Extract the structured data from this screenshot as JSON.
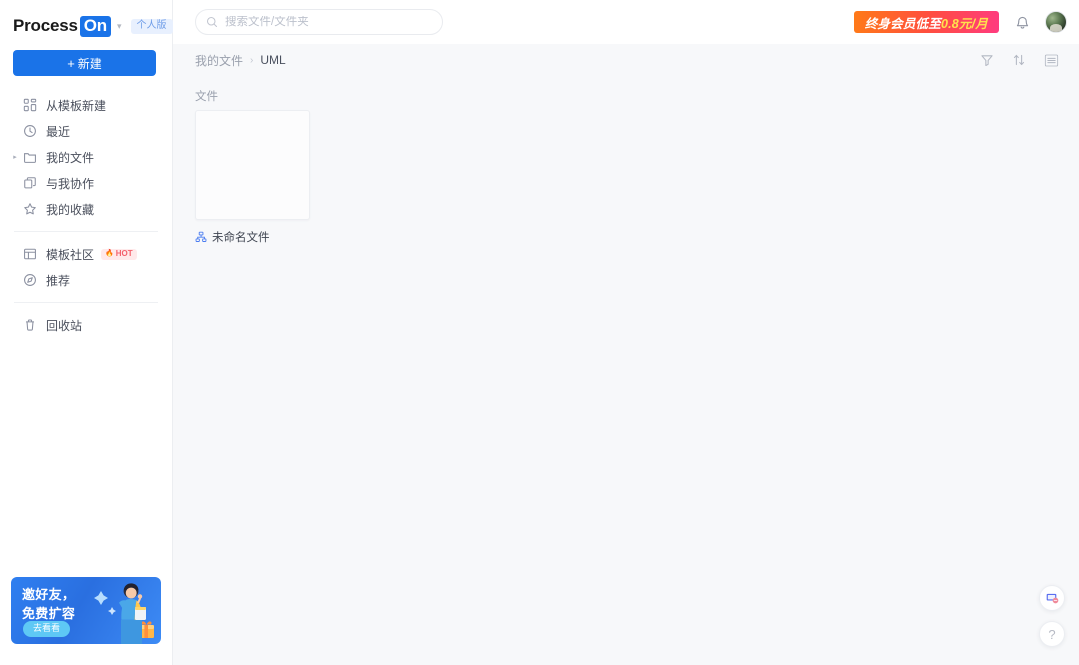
{
  "brand": {
    "name_part1": "Process",
    "name_part2": "On",
    "caret": "▾",
    "edition_badge": "个人版",
    "logo_bg": "#1a73e8"
  },
  "sidebar": {
    "new_button": {
      "icon": "plus-icon",
      "plus": "+",
      "label": "新建"
    },
    "items": [
      {
        "icon": "template-grid-icon",
        "label": "从模板新建",
        "expandable": false
      },
      {
        "icon": "clock-icon",
        "label": "最近",
        "expandable": false
      },
      {
        "icon": "folder-icon",
        "label": "我的文件",
        "expandable": true,
        "expand_caret": "▸"
      },
      {
        "icon": "collaborate-icon",
        "label": "与我协作",
        "expandable": false
      },
      {
        "icon": "star-icon",
        "label": "我的收藏",
        "expandable": false
      },
      {
        "icon": "community-icon",
        "label": "模板社区",
        "expandable": false,
        "badge": "HOT"
      },
      {
        "icon": "compass-icon",
        "label": "推荐",
        "expandable": false
      },
      {
        "icon": "trash-icon",
        "label": "回收站",
        "expandable": false
      }
    ],
    "separator_after_indices": [
      4,
      6
    ],
    "promo": {
      "line1": "邀好友，",
      "line2": "免费扩容",
      "button": "去看看",
      "bg_color": "#2f7ff0",
      "button_color": "#5ec8f5"
    }
  },
  "topbar": {
    "search": {
      "icon": "search-icon",
      "placeholder": "搜索文件/文件夹",
      "value": ""
    },
    "member_banner": {
      "text_prefix": "终身会员低至",
      "text_highlight": "0.8元/月",
      "highlight_color": "#ffe14d",
      "gradient_from": "#ff7a18",
      "gradient_to": "#ff3b7f"
    },
    "bell": {
      "icon": "bell-icon"
    },
    "avatar": {
      "icon": "avatar"
    }
  },
  "content": {
    "breadcrumb": {
      "parent": "我的文件",
      "separator": "›",
      "current": "UML"
    },
    "tools": [
      {
        "icon": "filter-icon",
        "name": "filter-button"
      },
      {
        "icon": "sort-icon",
        "name": "sort-button"
      },
      {
        "icon": "list-view-icon",
        "name": "view-toggle-button"
      }
    ],
    "section_label": "文件",
    "files": [
      {
        "icon": "diagram-icon",
        "name": "未命名文件"
      }
    ]
  },
  "float_widgets": [
    {
      "icon": "feedback-screen-icon",
      "name": "feedback-button"
    },
    {
      "icon": "help-icon",
      "name": "help-button",
      "glyph": "?"
    }
  ]
}
